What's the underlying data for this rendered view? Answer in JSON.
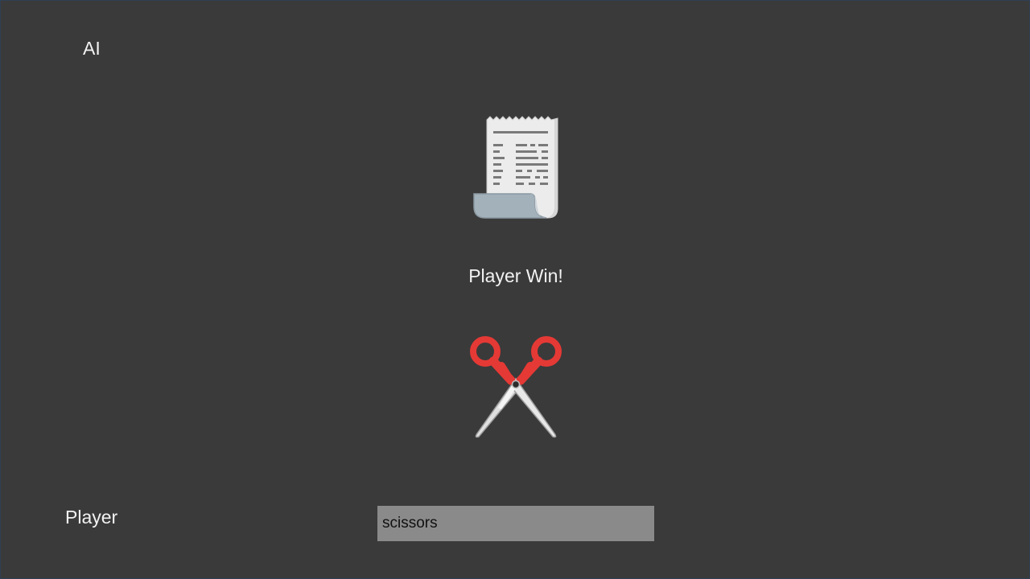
{
  "labels": {
    "ai": "AI",
    "player": "Player"
  },
  "result": {
    "text": "Player Win!"
  },
  "ai_choice": {
    "icon": "receipt-paper-icon"
  },
  "player_choice": {
    "icon": "scissors-icon"
  },
  "input": {
    "value": "scissors"
  },
  "colors": {
    "background": "#3a3a3a",
    "text": "#f2f2f2",
    "input_bg": "#8a8a8a",
    "scissors_handle": "#e53935"
  }
}
